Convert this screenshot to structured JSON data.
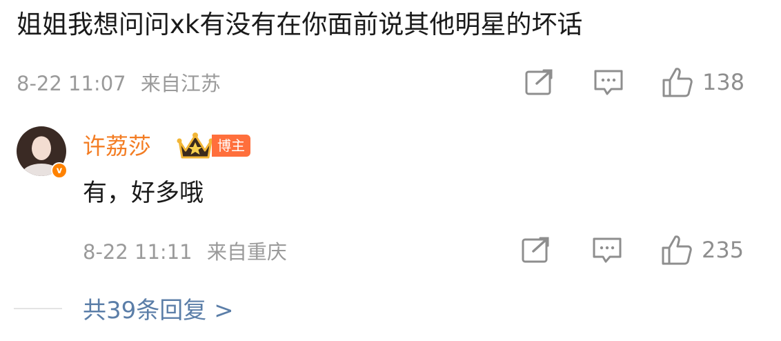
{
  "comment": {
    "text": "姐姐我想问问xk有没有在你面前说其他明星的坏话",
    "timestamp": "8-22 11:07",
    "location": "来自江苏",
    "like_count": "138"
  },
  "reply": {
    "username": "许荔莎",
    "role_badge": "博主",
    "text": "有，好多哦",
    "timestamp": "8-22 11:11",
    "location": "来自重庆",
    "like_count": "235",
    "verified_mark": "v"
  },
  "more_replies": "共39条回复 >",
  "colors": {
    "username": "#f37d24",
    "host_badge": "#ff6f3c",
    "link": "#5b7ea8",
    "meta": "#9a9a9a"
  }
}
